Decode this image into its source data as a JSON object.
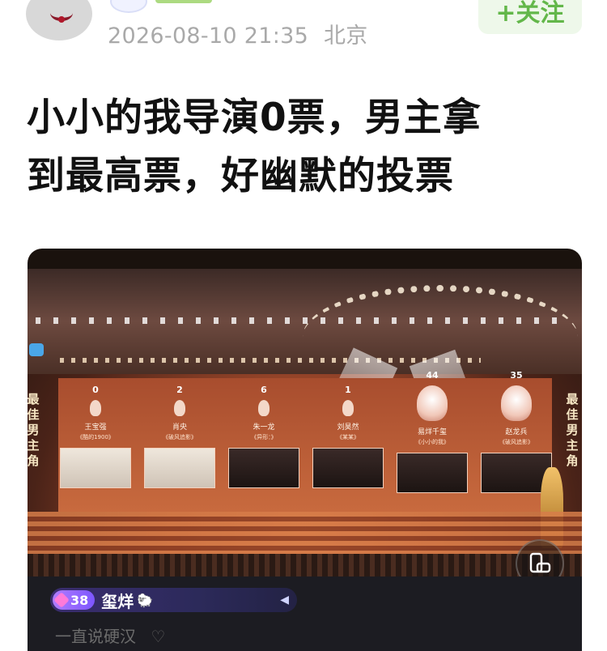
{
  "post": {
    "meta_time": "2026-08-10 21:35",
    "meta_location": "北京",
    "follow_label": "+关注",
    "title_line1": "小小的我导演0票，男主拿",
    "title_line2": "到最高票，好幽默的投票"
  },
  "video": {
    "side_caption_left": "最佳男主角",
    "side_caption_right": "最佳男主角",
    "nominees": [
      {
        "votes": "0",
        "name": "王宝强",
        "film": "《酷的1900》",
        "winner": false
      },
      {
        "votes": "2",
        "name": "肖央",
        "film": "《破风追影》",
        "winner": false
      },
      {
        "votes": "6",
        "name": "朱一龙",
        "film": "《异形：》",
        "winner": false
      },
      {
        "votes": "1",
        "name": "刘昊然",
        "film": "《某某》",
        "winner": false
      },
      {
        "votes": "44",
        "name": "易烊千玺",
        "film": "《小小的我》",
        "winner": true
      },
      {
        "votes": "35",
        "name": "赵龙兵",
        "film": "《破风追影》",
        "winner": true
      }
    ],
    "live_user": {
      "level": "38",
      "name": "玺烊",
      "sheep_icon": "sheep-icon"
    },
    "comment_text": "一直说硬汉",
    "colors": {
      "follow_text": "#63b74a",
      "follow_bg": "#eef8ea",
      "meta_text": "#a9a9a9",
      "title_text": "#111111"
    }
  }
}
